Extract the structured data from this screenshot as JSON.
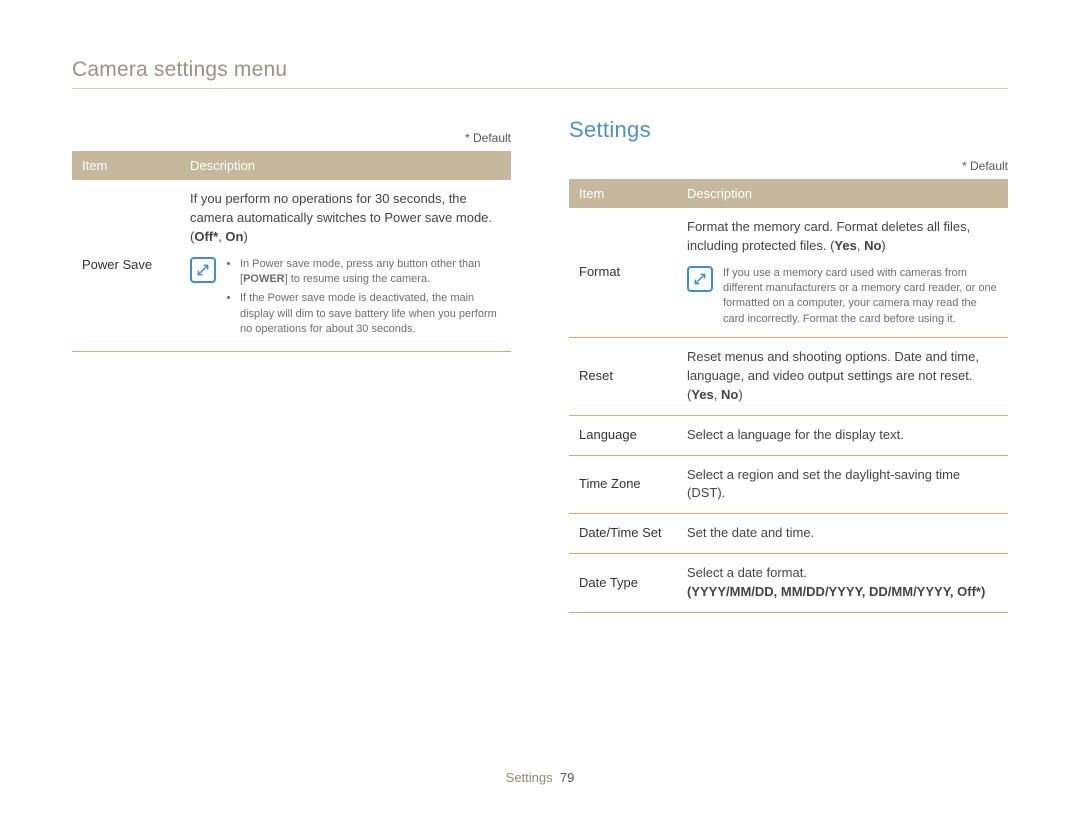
{
  "page_title": "Camera settings menu",
  "default_marker": "* Default",
  "headers": {
    "item": "Item",
    "description": "Description"
  },
  "right_heading": "Settings",
  "footer": {
    "section": "Settings",
    "page": "79"
  },
  "left_table": {
    "rows": [
      {
        "item": "Power Save",
        "intro": "If you perform no operations for 30 seconds, the camera automatically switches to Power save mode.",
        "options_prefix": "(",
        "option_bold1": "Off*",
        "options_sep": ", ",
        "option_bold2": "On",
        "options_suffix": ")",
        "note_bullets": [
          {
            "pre": "In Power save mode, press any button other than [",
            "kbd": "POWER",
            "post": "] to resume using the camera."
          },
          {
            "text": "If the Power save mode is deactivated, the main display will dim to save battery life when you perform no operations for about 30 seconds."
          }
        ]
      }
    ]
  },
  "right_table": {
    "rows": [
      {
        "item": "Format",
        "intro_pre": "Format the memory card. Format deletes all files, including protected files. (",
        "opt1": "Yes",
        "sep": ", ",
        "opt2": "No",
        "intro_post": ")",
        "note": "If you use a memory card used with cameras from different manufacturers or a memory card reader, or one formatted on a computer, your camera may read the card incorrectly. Format the card before using it."
      },
      {
        "item": "Reset",
        "intro_pre": "Reset menus and shooting options. Date and time, language, and video output settings are not reset. (",
        "opt1": "Yes",
        "sep": ", ",
        "opt2": "No",
        "intro_post": ")"
      },
      {
        "item": "Language",
        "desc": "Select a language for the display text."
      },
      {
        "item": "Time Zone",
        "desc": "Select a region and set the daylight-saving time (DST)."
      },
      {
        "item": "Date/Time Set",
        "desc": "Set the date and time."
      },
      {
        "item": "Date Type",
        "desc_pre": "Select a date format.",
        "opts": "(YYYY/MM/DD, MM/DD/YYYY, DD/MM/YYYY, Off*)"
      }
    ]
  }
}
